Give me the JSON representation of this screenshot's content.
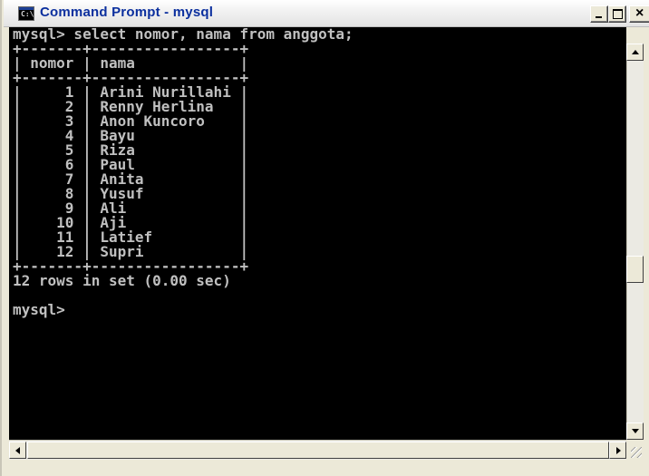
{
  "window": {
    "title": "Command Prompt - mysql",
    "app_icon_text": "C:\\"
  },
  "console": {
    "lines": [
      "mysql> select nomor, nama from anggota;",
      "+-------+-----------------+",
      "| nomor | nama            |",
      "+-------+-----------------+",
      "|     1 | Arini Nurillahi |",
      "|     2 | Renny Herlina   |",
      "|     3 | Anon Kuncoro    |",
      "|     4 | Bayu            |",
      "|     5 | Riza            |",
      "|     6 | Paul            |",
      "|     7 | Anita           |",
      "|     8 | Yusuf           |",
      "|     9 | Ali             |",
      "|    10 | Aji             |",
      "|    11 | Latief          |",
      "|    12 | Supri           |",
      "+-------+-----------------+",
      "12 rows in set (0.00 sec)",
      "",
      "mysql>"
    ]
  },
  "query_result": {
    "columns": [
      "nomor",
      "nama"
    ],
    "rows": [
      [
        "1",
        "Arini Nurillahi"
      ],
      [
        "2",
        "Renny Herlina"
      ],
      [
        "3",
        "Anon Kuncoro"
      ],
      [
        "4",
        "Bayu"
      ],
      [
        "5",
        "Riza"
      ],
      [
        "6",
        "Paul"
      ],
      [
        "7",
        "Anita"
      ],
      [
        "8",
        "Yusuf"
      ],
      [
        "9",
        "Ali"
      ],
      [
        "10",
        "Aji"
      ],
      [
        "11",
        "Latief"
      ],
      [
        "12",
        "Supri"
      ]
    ]
  },
  "colors": {
    "console_bg": "#000000",
    "console_text": "#c0c0c0",
    "title_text": "#0b2f9e"
  }
}
